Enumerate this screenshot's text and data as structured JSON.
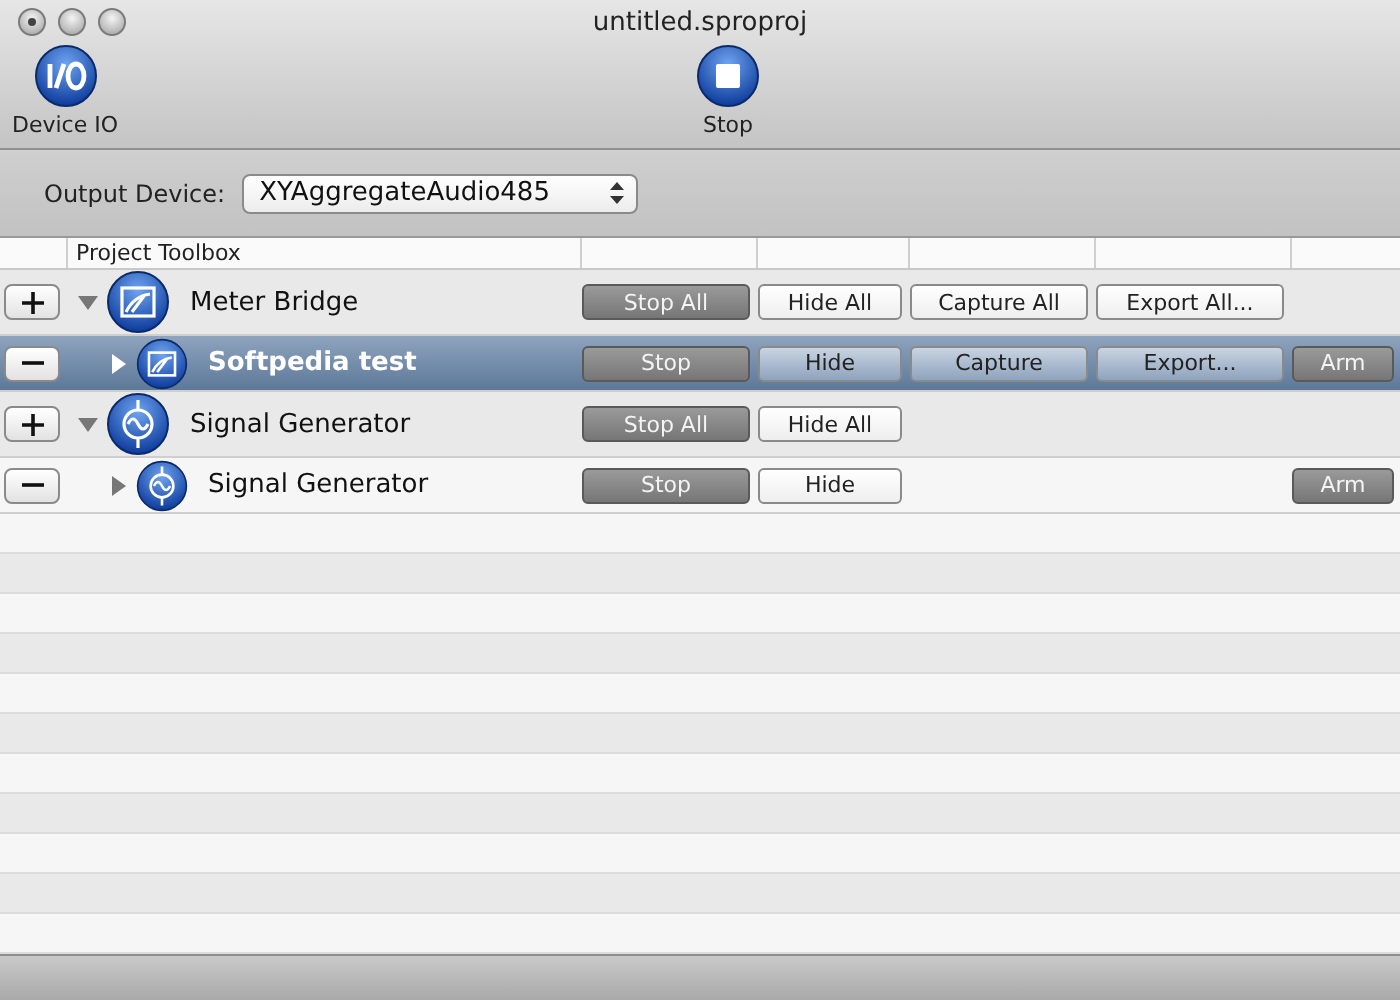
{
  "window": {
    "title": "untitled.sproproj"
  },
  "toolbar": [
    {
      "label": "Device IO",
      "kind": "io"
    },
    {
      "label": "Stop",
      "kind": "stop"
    }
  ],
  "output_device": {
    "label": "Output Device:",
    "value": "XYAggregateAudio485"
  },
  "table": {
    "columns": [
      "Project Toolbox"
    ],
    "rows": [
      {
        "kind": "meter",
        "name": "Meter Bridge",
        "expanded": true,
        "selected": false,
        "buttons": [
          {
            "label": "Stop All",
            "kind": "stop",
            "pressed": true
          },
          {
            "label": "Hide All",
            "kind": "hide",
            "pressed": false
          },
          {
            "label": "Capture All",
            "kind": "capture",
            "pressed": false
          },
          {
            "label": "Export All...",
            "kind": "export",
            "pressed": false
          }
        ],
        "children": [
          {
            "name": "Softpedia test",
            "expanded": false,
            "selected": true,
            "buttons": [
              {
                "label": "Stop",
                "kind": "stop",
                "pressed": true
              },
              {
                "label": "Hide",
                "kind": "hide",
                "pressed": false
              },
              {
                "label": "Capture",
                "kind": "capture",
                "pressed": false
              },
              {
                "label": "Export...",
                "kind": "export",
                "pressed": false
              },
              {
                "label": "Arm",
                "kind": "arm",
                "pressed": true
              }
            ]
          }
        ]
      },
      {
        "kind": "signal",
        "name": "Signal Generator",
        "expanded": true,
        "selected": false,
        "buttons": [
          {
            "label": "Stop All",
            "kind": "stop",
            "pressed": true
          },
          {
            "label": "Hide All",
            "kind": "hide",
            "pressed": false
          }
        ],
        "children": [
          {
            "name": "Signal Generator",
            "expanded": false,
            "selected": false,
            "buttons": [
              {
                "label": "Stop",
                "kind": "stop",
                "pressed": true
              },
              {
                "label": "Hide",
                "kind": "hide",
                "pressed": false
              },
              {
                "label": "Arm",
                "kind": "arm",
                "pressed": true
              }
            ]
          }
        ]
      }
    ]
  }
}
